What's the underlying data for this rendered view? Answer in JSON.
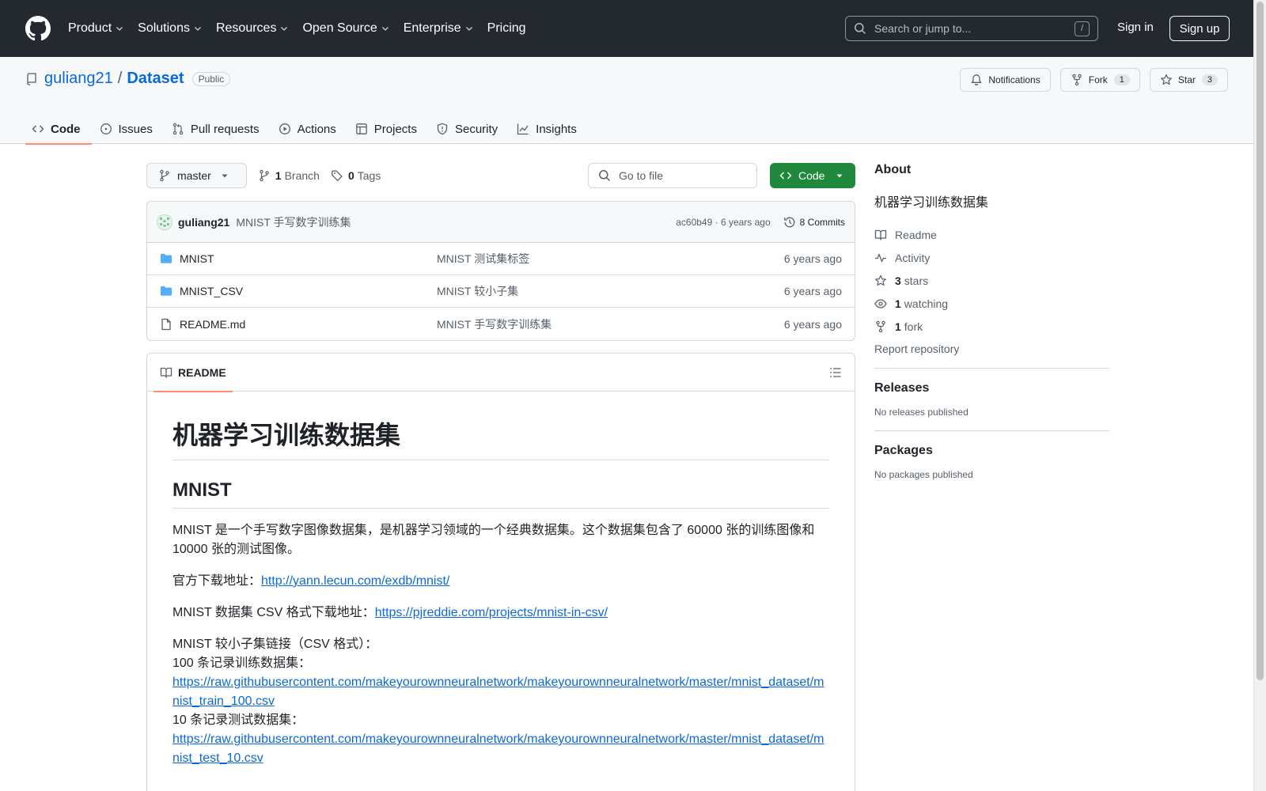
{
  "header": {
    "nav": [
      {
        "label": "Product",
        "has_menu": true
      },
      {
        "label": "Solutions",
        "has_menu": true
      },
      {
        "label": "Resources",
        "has_menu": true
      },
      {
        "label": "Open Source",
        "has_menu": true
      },
      {
        "label": "Enterprise",
        "has_menu": true
      },
      {
        "label": "Pricing",
        "has_menu": false
      }
    ],
    "search_placeholder": "Search or jump to...",
    "search_key": "/",
    "sign_in": "Sign in",
    "sign_up": "Sign up"
  },
  "repo": {
    "owner": "guliang21",
    "separator": "/",
    "name": "Dataset",
    "visibility": "Public",
    "notifications_label": "Notifications",
    "fork_label": "Fork",
    "fork_count": "1",
    "star_label": "Star",
    "star_count": "3"
  },
  "tabs": [
    "Code",
    "Issues",
    "Pull requests",
    "Actions",
    "Projects",
    "Security",
    "Insights"
  ],
  "file_nav": {
    "branch": "master",
    "branch_count": "1",
    "branch_label": "Branch",
    "tag_count": "0",
    "tag_label": "Tags",
    "goto_placeholder": "Go to file",
    "code_button": "Code"
  },
  "commit": {
    "author": "guliang21",
    "message": "MNIST 手写数字训练集",
    "hash_age": "ac60b49 · 6 years ago",
    "commits": "8 Commits"
  },
  "files": [
    {
      "type": "dir",
      "name": "MNIST",
      "message": "MNIST 测试集标签",
      "age": "6 years ago"
    },
    {
      "type": "dir",
      "name": "MNIST_CSV",
      "message": "MNIST 较小子集",
      "age": "6 years ago"
    },
    {
      "type": "file",
      "name": "README.md",
      "message": "MNIST 手写数字训练集",
      "age": "6 years ago"
    }
  ],
  "readme": {
    "tab": "README",
    "h1": "机器学习训练数据集",
    "h2": "MNIST",
    "p1": "MNIST 是一个手写数字图像数据集，是机器学习领域的一个经典数据集。这个数据集包含了 60000 张的训练图像和 10000 张的测试图像。",
    "p2_label": "官方下载地址：",
    "p2_link": "http://yann.lecun.com/exdb/mnist/",
    "p3_label": "MNIST 数据集 CSV 格式下载地址：",
    "p3_link": "https://pjreddie.com/projects/mnist-in-csv/",
    "p4_line1": "MNIST 较小子集链接（CSV 格式）：",
    "p4_line2": "100 条记录训练数据集：",
    "p4_link1": "https://raw.githubusercontent.com/makeyourownneuralnetwork/makeyourownneuralnetwork/master/mnist_dataset/mnist_train_100.csv",
    "p4_line3": "10 条记录测试数据集：",
    "p4_link2": "https://raw.githubusercontent.com/makeyourownneuralnetwork/makeyourownneuralnetwork/master/mnist_dataset/mnist_test_10.csv"
  },
  "sidebar": {
    "about_title": "About",
    "description": "机器学习训练数据集",
    "readme": "Readme",
    "activity": "Activity",
    "stars_count": "3",
    "stars_label": "stars",
    "watching_count": "1",
    "watching_label": "watching",
    "fork_count": "1",
    "fork_label": "fork",
    "report": "Report repository",
    "releases_title": "Releases",
    "releases_text": "No releases published",
    "packages_title": "Packages",
    "packages_text": "No packages published"
  },
  "colors": {
    "header_bg": "#24292f",
    "link": "#0969da",
    "primary_button": "#1f883d",
    "tab_underline": "#fd8c73",
    "folder": "#54aeff"
  }
}
